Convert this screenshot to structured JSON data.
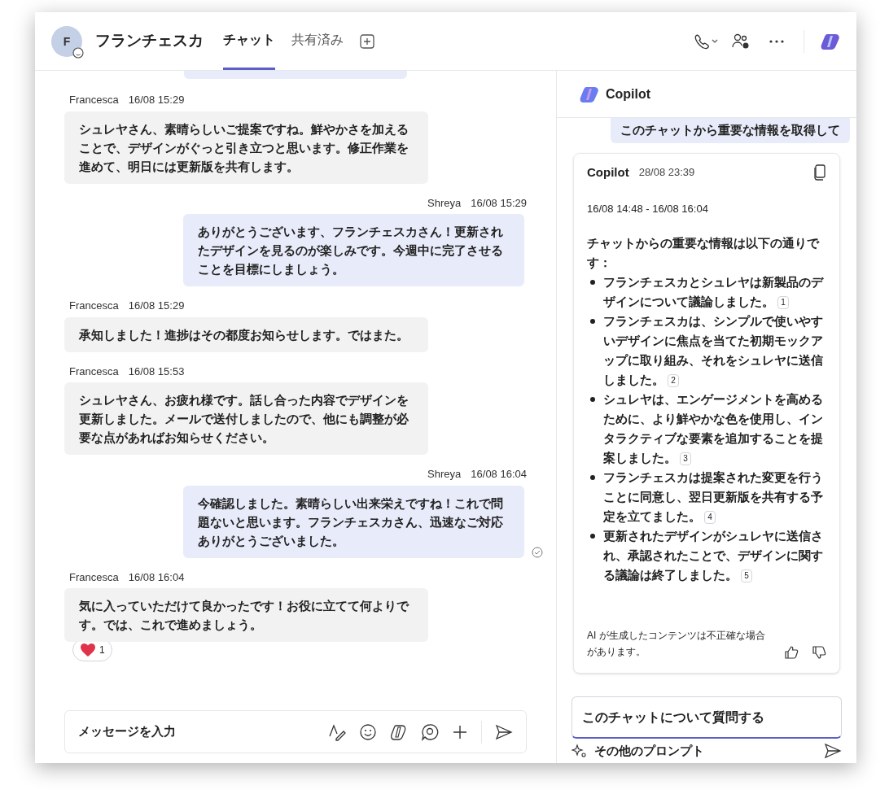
{
  "header": {
    "avatar_initial": "F",
    "title": "フランチェスカ",
    "tabs": [
      {
        "label": "チャット",
        "selected": true
      },
      {
        "label": "共有済み",
        "selected": false
      }
    ]
  },
  "messages": [
    {
      "kind": "received",
      "author": "Francesca",
      "time": "16/08 15:29",
      "text": "シュレヤさん、素晴らしいご提案ですね。鮮やかさを加えることで、デザインがぐっと引き立つと思います。修正作業を進めて、明日には更新版を共有します。",
      "read": false
    },
    {
      "kind": "sent",
      "author": "Shreya",
      "time": "16/08 15:29",
      "text": "ありがとうございます、フランチェスカさん！更新されたデザインを見るのが楽しみです。今週中に完了させることを目標にしましょう。",
      "read": false
    },
    {
      "kind": "received",
      "author": "Francesca",
      "time": "16/08 15:29",
      "text": "承知しました！進捗はその都度お知らせします。ではまた。",
      "read": false
    },
    {
      "kind": "received",
      "author": "Francesca",
      "time": "16/08 15:53",
      "text": "シュレヤさん、お疲れ様です。話し合った内容でデザインを更新しました。メールで送付しましたので、他にも調整が必要な点があればお知らせください。",
      "read": false
    },
    {
      "kind": "sent",
      "author": "Shreya",
      "time": "16/08 16:04",
      "text": "今確認しました。素晴らしい出来栄えですね！これで問題ないと思います。フランチェスカさん、迅速なご対応ありがとうございました。",
      "read": true
    },
    {
      "kind": "received",
      "author": "Francesca",
      "time": "16/08 16:04",
      "text": "気に入っていただけて良かったです！お役に立てて何よりです。では、これで進めましょう。",
      "read": false,
      "reaction_count": "1"
    }
  ],
  "composer": {
    "placeholder": "メッセージを入力"
  },
  "copilot": {
    "title": "Copilot",
    "prompt": "このチャットから重要な情報を取得して",
    "response": {
      "author": "Copilot",
      "time": "28/08 23:39",
      "range": "16/08 14:48 - 16/08 16:04",
      "intro": "チャットからの重要な情報は以下の通りです：",
      "items": [
        {
          "text": "フランチェスカとシュレヤは新製品のデザインについて議論しました。",
          "citation": "1"
        },
        {
          "text": "フランチェスカは、シンプルで使いやすいデザインに焦点を当てた初期モックアップに取り組み、それをシュレヤに送信しました。",
          "citation": "2"
        },
        {
          "text": "シュレヤは、エンゲージメントを高めるために、より鮮やかな色を使用し、インタラクティブな要素を追加することを提案しました。",
          "citation": "3"
        },
        {
          "text": "フランチェスカは提案された変更を行うことに同意し、翌日更新版を共有する予定を立てました。",
          "citation": "4"
        },
        {
          "text": "更新されたデザインがシュレヤに送信され、承認されたことで、デザインに関する議論は終了しました。",
          "citation": "5"
        }
      ],
      "disclaimer": "AI が生成したコンテンツは不正確な場合があります。"
    },
    "input_placeholder": "このチャットについて質問する",
    "more_prompts": "その他のプロンプト"
  }
}
